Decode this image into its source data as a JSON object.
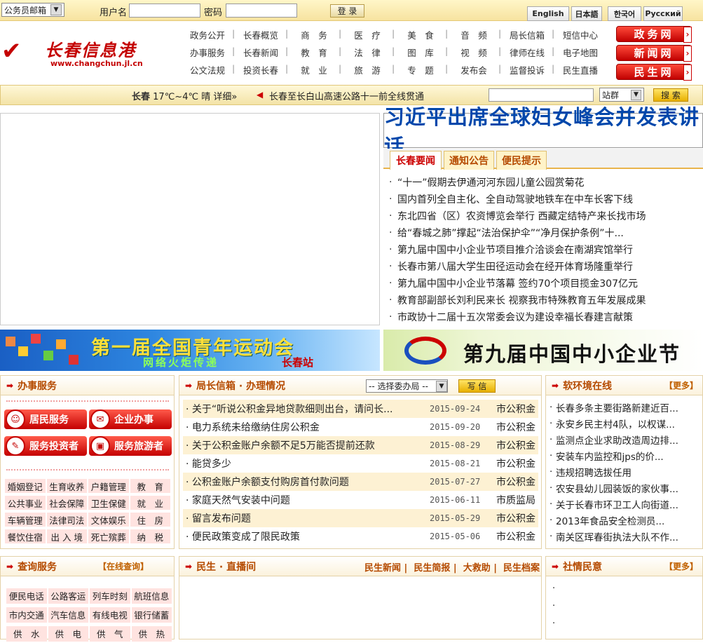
{
  "topbar": {
    "mail_select": "公务员邮箱",
    "username_label": "用户名",
    "password_label": "密码",
    "login_button": "登 录",
    "languages": [
      "English",
      "日本語",
      "한국어",
      "Русский"
    ]
  },
  "header": {
    "logo_name": "长春信息港",
    "logo_url": "www.changchun.jl.cn",
    "nav_rows": [
      [
        "政务公开",
        "长春概览",
        "商　务",
        "医　疗",
        "美　食",
        "音　频",
        "局长信箱",
        "短信中心"
      ],
      [
        "办事服务",
        "长春新闻",
        "教　育",
        "法　律",
        "图　库",
        "视　频",
        "律师在线",
        "电子地图"
      ],
      [
        "公文法规",
        "投资长春",
        "就　业",
        "旅　游",
        "专　题",
        "发布会",
        "监督投诉",
        "民生直播"
      ]
    ],
    "side_buttons": [
      "政务网",
      "新闻网",
      "民生网"
    ]
  },
  "infobar": {
    "city": "长春",
    "weather": "17℃~4℃ 晴 详细»",
    "notice": "长春至长白山高速公路十一前全线贯通",
    "site_select": "站群",
    "search_button": "搜 索"
  },
  "headline": "习近平出席全球妇女峰会并发表讲话",
  "news_tabs": [
    "长春要闻",
    "通知公告",
    "便民提示"
  ],
  "news_items": [
    "“十一”假期去伊通河河东园儿童公园赏菊花",
    "国内首列全自主化、全自动驾驶地铁车在中车长客下线",
    "东北四省（区）农资博览会举行 西藏定结特产来长找市场",
    "给“春城之肺”撑起“法治保护伞”“净月保护条例”十...",
    "第九届中国中小企业节项目推介洽谈会在南湖宾馆举行",
    "长春市第八届大学生田径运动会在经开体育场隆重举行",
    "第九届中国中小企业节落幕 签约70个项目揽金307亿元",
    "教育部副部长刘利民来长 视察我市特殊教育五年发展成果",
    "市政协十二届十五次常委会议为建设幸福长春建言献策"
  ],
  "banner1": {
    "title": "第一届全国青年运动会",
    "sub": "网络火炬传递",
    "city": "长春站"
  },
  "banner2": {
    "title": "第九届中国中小企业节"
  },
  "services": {
    "title": "办事服务",
    "buttons": [
      "居民服务",
      "企业办事",
      "服务投资者",
      "服务旅游者"
    ],
    "links": [
      [
        "婚姻登记",
        "生育收养",
        "户籍管理",
        "教　育"
      ],
      [
        "公共事业",
        "社会保障",
        "卫生保健",
        "就　业"
      ],
      [
        "车辆管理",
        "法律司法",
        "文体娱乐",
        "住　房"
      ],
      [
        "餐饮住宿",
        "出 入 境",
        "死亡殡葬",
        "纳　税"
      ]
    ]
  },
  "mailbox": {
    "title": "局长信箱 · 办理情况",
    "dept_select": "-- 选择委办局 --",
    "write_button": "写 信",
    "items": [
      {
        "title": "关于“听说公积金异地贷款细则出台，请问长...",
        "date": "2015-09-24",
        "source": "市公积金"
      },
      {
        "title": "电力系统未给缴纳住房公积金",
        "date": "2015-09-20",
        "source": "市公积金"
      },
      {
        "title": "关于公积金账户余额不足5万能否提前还款",
        "date": "2015-08-29",
        "source": "市公积金"
      },
      {
        "title": "能贷多少",
        "date": "2015-08-21",
        "source": "市公积金"
      },
      {
        "title": "公积金账户余额支付购房首付款问题",
        "date": "2015-07-27",
        "source": "市公积金"
      },
      {
        "title": "家庭天然气安装中问题",
        "date": "2015-06-11",
        "source": "市质监局"
      },
      {
        "title": "留言发布问题",
        "date": "2015-05-29",
        "source": "市公积金"
      },
      {
        "title": "便民政策变成了限民政策",
        "date": "2015-05-06",
        "source": "市公积金"
      }
    ]
  },
  "soft_env": {
    "title": "软环境在线",
    "more": "【更多】",
    "items": [
      "长春多条主要街路新建近百...",
      "永安乡民主村4队，以权谋...",
      "监测点企业求助改造周边排...",
      "安装车内监控和jps的价...",
      "违规招聘选拔任用",
      "农安县幼儿园装饭的家伙事...",
      "关于长春市环卫工人向街道...",
      "2013年食品安全检测员...",
      "南关区珲春街执法大队不作..."
    ]
  },
  "query": {
    "title": "查询服务",
    "online": "【在线查询】",
    "links": [
      [
        "便民电话",
        "公路客运",
        "列车时刻",
        "航班信息"
      ],
      [
        "市内交通",
        "汽车信息",
        "有线电视",
        "银行储蓄"
      ],
      [
        "供　水",
        "供　电",
        "供　气",
        "供　热"
      ]
    ]
  },
  "live": {
    "title": "民生 · 直播间",
    "links": [
      "民生新闻",
      "民生简报",
      "大救助",
      "民生档案"
    ]
  },
  "opinion": {
    "title": "社情民意",
    "more": "【更多】",
    "items": [
      "",
      "",
      ""
    ]
  }
}
